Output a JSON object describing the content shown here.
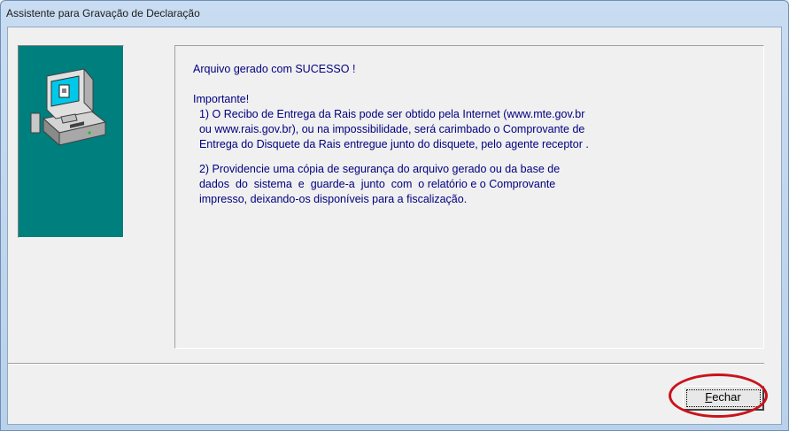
{
  "window": {
    "title": "Assistente para Gravação de Declaração"
  },
  "message": {
    "lines": [
      "Arquivo gerado com SUCESSO !",
      "",
      "Importante!",
      "  1) O Recibo de Entrega da Rais pode ser obtido pela Internet (www.mte.gov.br",
      "  ou www.rais.gov.br), ou na impossibilidade, será carimbado o Comprovante de",
      "  Entrega do Disquete da Rais entregue junto do disquete, pelo agente receptor .",
      "",
      "  2) Providencie uma cópia de segurança do arquivo gerado ou da base de",
      "  dados  do  sistema  e  guarde-a  junto  com  o relatório e o Comprovante",
      "  impresso, deixando-os disponíveis para a fiscalização."
    ]
  },
  "buttons": {
    "close_label_first": "F",
    "close_label_rest": "echar"
  },
  "colors": {
    "side_panel": "#007f7f",
    "message_text": "#000080",
    "highlight": "#c8141b"
  },
  "icons": {
    "side_panel_icon": "computer-icon"
  }
}
